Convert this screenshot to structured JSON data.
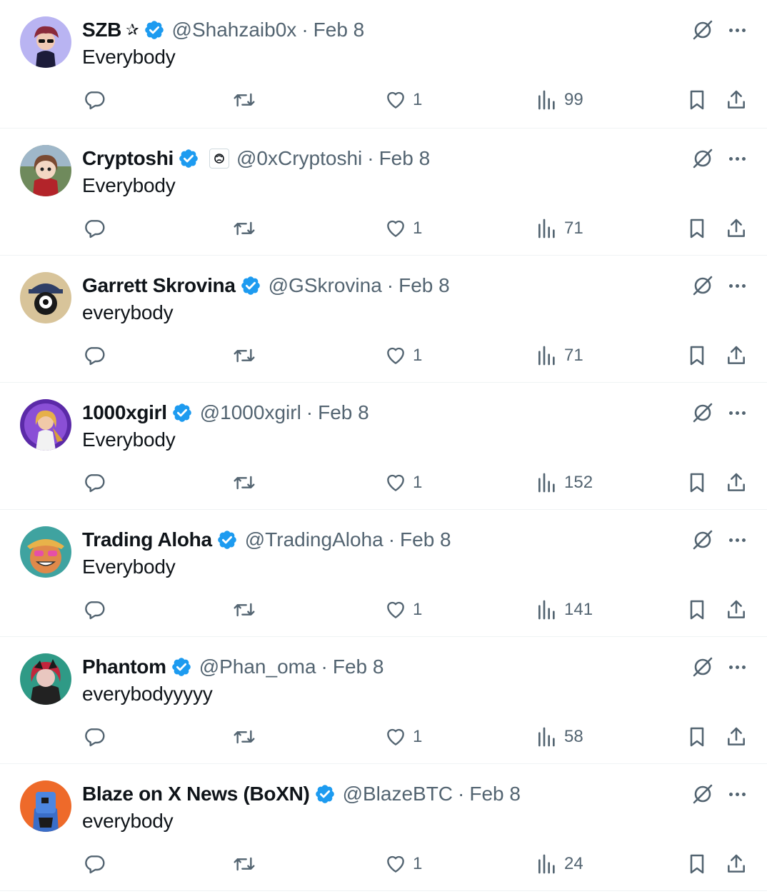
{
  "colors": {
    "verified": "#1d9bf0",
    "muted": "#536471",
    "text": "#0f1419"
  },
  "tweets": [
    {
      "name": "SZB",
      "star": "✰",
      "handle": "@Shahzaib0x",
      "sep": "·",
      "date": "Feb 8",
      "text": "Everybody",
      "likes": "1",
      "views": "99",
      "avatar": "avatar-szb"
    },
    {
      "name": "Cryptoshi",
      "affiliate": true,
      "handle": "@0xCryptoshi",
      "sep": "·",
      "date": "Feb 8",
      "text": "Everybody",
      "likes": "1",
      "views": "71",
      "avatar": "avatar-cryptoshi"
    },
    {
      "name": "Garrett Skrovina",
      "handle": "@GSkrovina",
      "sep": "·",
      "date": "Feb 8",
      "text": "everybody",
      "likes": "1",
      "views": "71",
      "avatar": "avatar-garrett"
    },
    {
      "name": "1000xgirl",
      "handle": "@1000xgirl",
      "sep": "·",
      "date": "Feb 8",
      "text": "Everybody",
      "likes": "1",
      "views": "152",
      "avatar": "avatar-1000xgirl"
    },
    {
      "name": "Trading Aloha",
      "handle": "@TradingAloha",
      "sep": "·",
      "date": "Feb 8",
      "text": "Everybody",
      "likes": "1",
      "views": "141",
      "avatar": "avatar-tradingaloha"
    },
    {
      "name": "Phantom",
      "handle": "@Phan_oma",
      "sep": "·",
      "date": "Feb 8",
      "text": "everybodyyyyy",
      "likes": "1",
      "views": "58",
      "avatar": "avatar-phantom"
    },
    {
      "name": "Blaze on X News (BoXN)",
      "handle": "@BlazeBTC",
      "sep": "·",
      "date": "Feb 8",
      "text": "everybody",
      "likes": "1",
      "views": "24",
      "avatar": "avatar-blaze"
    }
  ]
}
